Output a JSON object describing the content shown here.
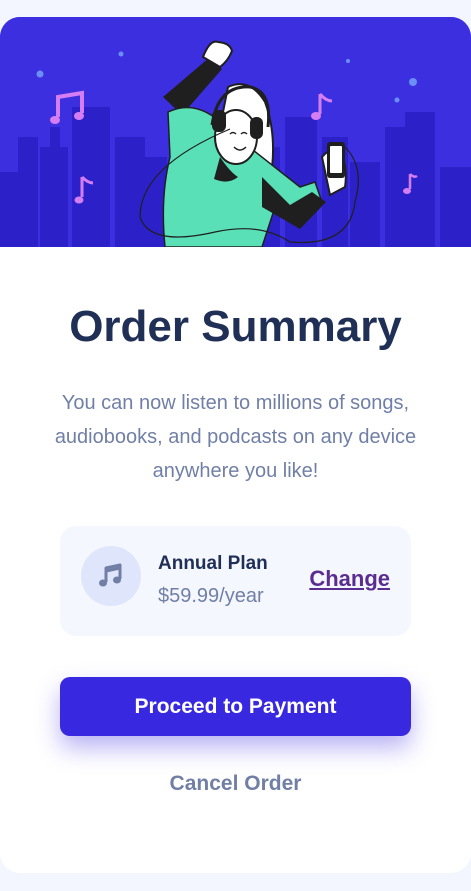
{
  "hero": {
    "illustration": "woman-listening-music-illustration",
    "background_color": "#3c2fe0"
  },
  "summary": {
    "title": "Order Summary",
    "description": "You can now listen to millions of songs, audiobooks, and podcasts on any device anywhere you like!"
  },
  "plan": {
    "icon": "music-note-icon",
    "name": "Annual Plan",
    "price": "$59.99/year",
    "change_label": "Change"
  },
  "actions": {
    "proceed_label": "Proceed to Payment",
    "cancel_label": "Cancel Order"
  },
  "colors": {
    "accent": "#3829e0",
    "title": "#1f2f56",
    "muted": "#717fa6",
    "link": "#5b2d91",
    "page_bg": "#f3f6fe"
  }
}
